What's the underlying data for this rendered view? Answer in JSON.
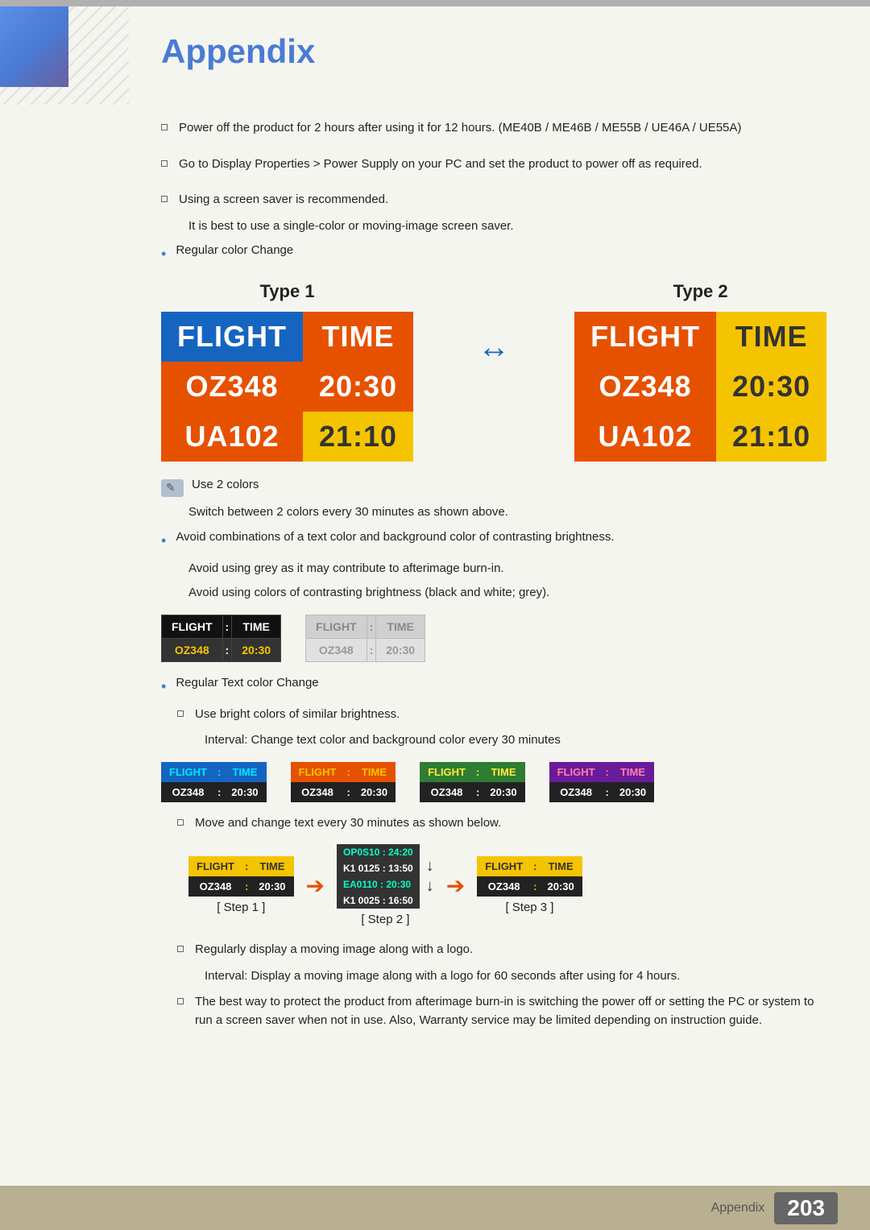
{
  "page": {
    "title": "Appendix",
    "footer_label": "Appendix",
    "footer_number": "203"
  },
  "bullets": {
    "item1": "Power off the product for 2 hours after using it for 12 hours. (ME40B / ME46B / ME55B / UE46A / UE55A)",
    "item2": "Go to Display Properties > Power Supply on your PC and set the product to power off as required.",
    "item3": "Using a screen saver is recommended.",
    "item3_sub": "It is best to use a single-color or moving-image screen saver.",
    "item4": "Regular color Change"
  },
  "types": {
    "type1_label": "Type 1",
    "type2_label": "Type 2",
    "flight": "FLIGHT",
    "time": "TIME",
    "oz348": "OZ348",
    "time1": "20:30",
    "ua102": "UA102",
    "time2": "21:10"
  },
  "note": {
    "text": "Use 2 colors",
    "sub": "Switch between 2 colors every 30 minutes as shown above."
  },
  "contrast_section": {
    "avoid1": "Avoid combinations of a text color and background color of contrasting brightness.",
    "avoid2": "Avoid using grey as it may contribute to afterimage burn-in.",
    "avoid3": "Avoid using colors of contrasting brightness (black and white; grey).",
    "flight": "FLIGHT",
    "colon": ":",
    "time": "TIME",
    "oz348": "OZ348",
    "time1": "20:30"
  },
  "regular_text": {
    "label": "Regular Text color Change",
    "sub1": "Use bright colors of similar brightness.",
    "interval": "Interval: Change text color and background color every 30 minutes"
  },
  "move_text": {
    "sub": "Move and change text every 30 minutes as shown below.",
    "step1": "[ Step 1 ]",
    "step2": "[ Step 2 ]",
    "step3": "[ Step 3 ]",
    "step2_lines": [
      "OP0S10 :  24:20",
      "K1 0125 :  13:50",
      "EA0110 :  20:30",
      "K1 0025 :  16:50"
    ]
  },
  "final_bullets": {
    "item1": "Regularly display a moving image along with a logo.",
    "item1_sub": "Interval: Display a moving image along with a logo for 60 seconds after using for 4 hours.",
    "item2": "The best way to protect the product from afterimage burn-in is switching the power off or setting the PC or system to run a screen saver when not in use. Also, Warranty service may be limited depending on instruction guide."
  }
}
